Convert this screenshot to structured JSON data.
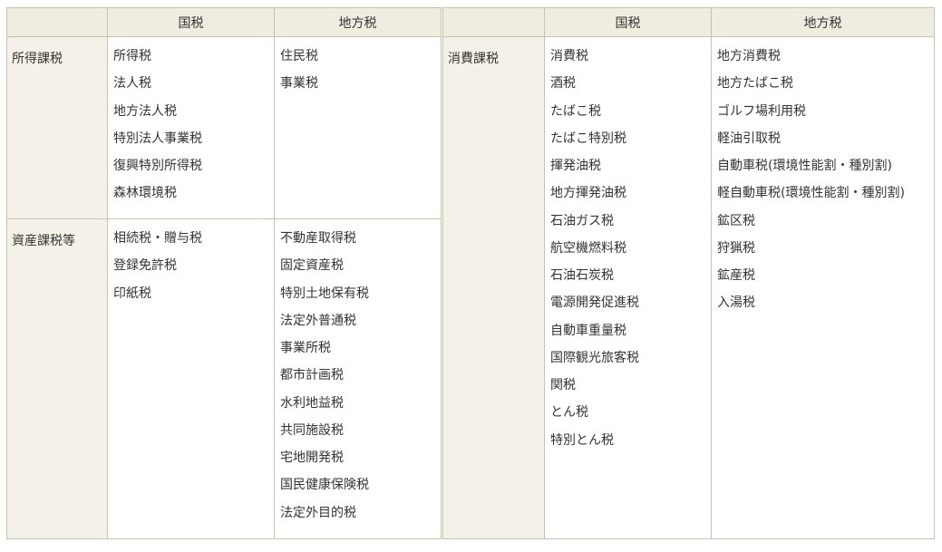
{
  "left_table": {
    "headers": [
      "国税",
      "地方税"
    ],
    "rows": [
      {
        "category": "所得課税",
        "national": [
          "所得税",
          "法人税",
          "地方法人税",
          "特別法人事業税",
          "復興特別所得税",
          "森林環境税"
        ],
        "local": [
          "住民税",
          "事業税"
        ]
      },
      {
        "category": "資産課税等",
        "national": [
          "相続税・贈与税",
          "登録免許税",
          "印紙税"
        ],
        "local": [
          "不動産取得税",
          "固定資産税",
          "特別土地保有税",
          "法定外普通税",
          "事業所税",
          "都市計画税",
          "水利地益税",
          "共同施設税",
          "宅地開発税",
          "国民健康保険税",
          "法定外目的税"
        ]
      }
    ]
  },
  "right_table": {
    "headers": [
      "国税",
      "地方税"
    ],
    "rows": [
      {
        "category": "消費課税",
        "national": [
          "消費税",
          "酒税",
          "たばこ税",
          "たばこ特別税",
          "揮発油税",
          "地方揮発油税",
          "石油ガス税",
          "航空機燃料税",
          "石油石炭税",
          "電源開発促進税",
          "自動車重量税",
          "国際観光旅客税",
          "関税",
          "とん税",
          "特別とん税"
        ],
        "local": [
          "地方消費税",
          "地方たばこ税",
          "ゴルフ場利用税",
          "軽油引取税",
          "自動車税(環境性能割・種別割)",
          "軽自動車税(環境性能割・種別割)",
          "鉱区税",
          "狩猟税",
          "鉱産税",
          "入湯税"
        ]
      }
    ]
  }
}
